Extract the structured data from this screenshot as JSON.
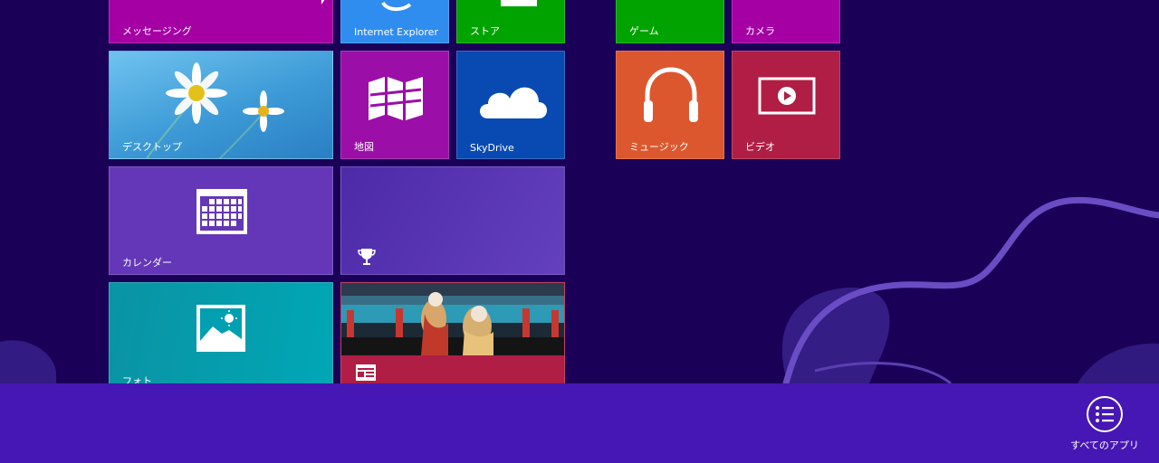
{
  "screen": {
    "background_color": "#1a0157",
    "accent_swirl_color": "#5b3fb2"
  },
  "tiles": {
    "messaging": {
      "label": "メッセージング",
      "color": "#a400a4",
      "icon": "messaging-icon"
    },
    "internet_explorer": {
      "label": "Internet Explorer",
      "color": "#2e8def",
      "icon": "internet-explorer-icon"
    },
    "store": {
      "label": "ストア",
      "color": "#00a300",
      "icon": "store-icon"
    },
    "games": {
      "label": "ゲーム",
      "color": "#00a300",
      "icon": "games-icon"
    },
    "camera": {
      "label": "カメラ",
      "color": "#a400a4",
      "icon": "camera-icon"
    },
    "desktop": {
      "label": "デスクトップ",
      "color": "#3d9ad6",
      "icon": "daisy-wallpaper-image"
    },
    "maps": {
      "label": "地図",
      "color": "#9b0fa8",
      "icon": "map-icon"
    },
    "skydrive": {
      "label": "SkyDrive",
      "color": "#094ab2",
      "icon": "cloud-icon"
    },
    "music": {
      "label": "ミュージック",
      "color": "#dc572e",
      "icon": "headphones-icon"
    },
    "video": {
      "label": "ビデオ",
      "color": "#b01e45",
      "icon": "video-player-icon"
    },
    "calendar": {
      "label": "カレンダー",
      "color": "#6437b8",
      "icon": "calendar-icon"
    },
    "sports": {
      "label": "",
      "color": "#5f3aba",
      "icon": "trophy-icon"
    },
    "photos": {
      "label": "フォト",
      "color": "#00a0b1",
      "icon": "photo-icon"
    },
    "news": {
      "label": "",
      "color": "#b01e45",
      "icon": "news-icon"
    }
  },
  "app_bar": {
    "background_color": "#4617b4",
    "all_apps_label": "すべてのアプリ",
    "all_apps_icon": "list-icon"
  }
}
